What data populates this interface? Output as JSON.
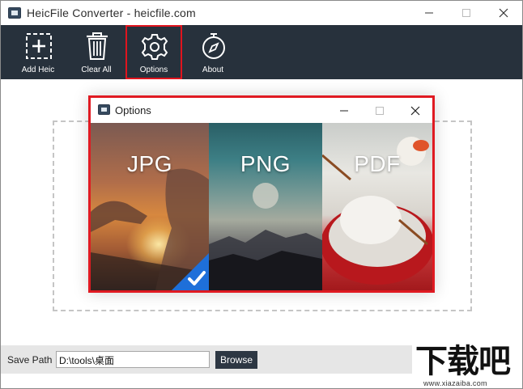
{
  "window": {
    "title": "HeicFile Converter - heicfile.com"
  },
  "toolbar": {
    "items": [
      {
        "label": "Add Heic",
        "icon": "add-box-icon"
      },
      {
        "label": "Clear All",
        "icon": "trash-icon"
      },
      {
        "label": "Options",
        "icon": "gear-icon",
        "selected": true
      },
      {
        "label": "About",
        "icon": "compass-icon"
      }
    ]
  },
  "dialog": {
    "title": "Options",
    "formats": [
      {
        "label": "JPG",
        "selected": true
      },
      {
        "label": "PNG",
        "selected": false
      },
      {
        "label": "PDF",
        "selected": false
      }
    ]
  },
  "footer": {
    "save_path_label": "Save Path",
    "save_path_value": "D:\\tools\\桌面",
    "browse_label": "Browse"
  },
  "watermark": {
    "text": "下载吧",
    "url": "www.xiazaiba.com"
  },
  "colors": {
    "toolbar_bg": "#27313c",
    "highlight": "#e0141e",
    "check_badge": "#1e6fd9",
    "browse_bg": "#2d3743"
  }
}
